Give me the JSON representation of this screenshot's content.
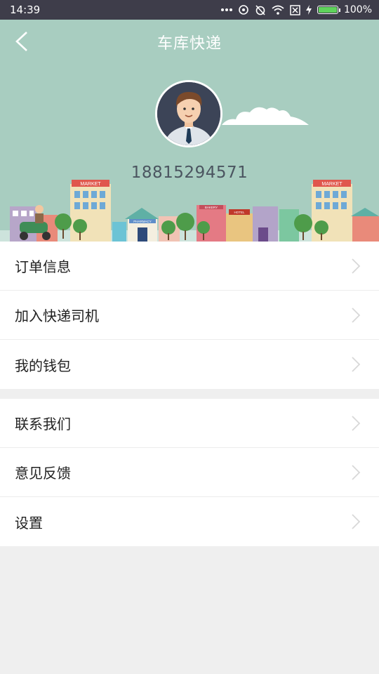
{
  "status_bar": {
    "time": "14:39",
    "battery_text": "100%",
    "battery_level": 1.0,
    "icons": [
      "more-dots-icon",
      "sync-icon",
      "alarm-off-icon",
      "wifi-icon",
      "sim-off-icon",
      "charging-icon",
      "battery-icon"
    ]
  },
  "header": {
    "title": "车库快递",
    "back_icon": "chevron-left-icon",
    "avatar": "user-avatar-icon",
    "phone": "18815294571",
    "background": "#a8cdc0"
  },
  "menu": {
    "group1": [
      {
        "label": "订单信息"
      },
      {
        "label": "加入快递司机"
      },
      {
        "label": "我的钱包"
      }
    ],
    "group2": [
      {
        "label": "联系我们"
      },
      {
        "label": "意见反馈"
      },
      {
        "label": "设置"
      }
    ]
  },
  "illustration": {
    "signs": [
      "MARKET",
      "MARKET",
      "PHARMACY",
      "BAKERY",
      "HOTEL"
    ]
  }
}
